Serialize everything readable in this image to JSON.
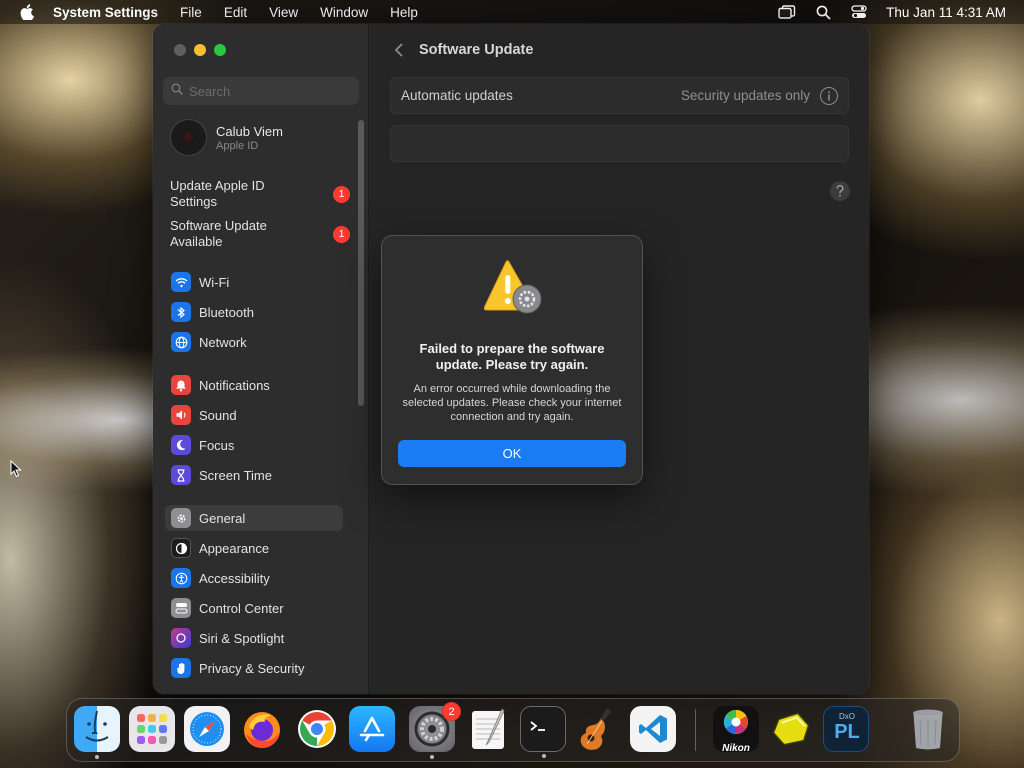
{
  "menubar": {
    "app_name": "System Settings",
    "menus": [
      "File",
      "Edit",
      "View",
      "Window",
      "Help"
    ],
    "clock": "Thu Jan 11  4:31 AM",
    "status_icons": [
      "stage-manager-icon",
      "spotlight-search-icon",
      "control-center-icon"
    ]
  },
  "window": {
    "sidebar": {
      "search_placeholder": "Search",
      "user": {
        "name": "Calub Viem",
        "subtitle": "Apple ID"
      },
      "notices": [
        {
          "label": "Update Apple ID Settings",
          "badge": "1"
        },
        {
          "label": "Software Update Available",
          "badge": "1"
        }
      ],
      "items": [
        {
          "label": "Wi-Fi",
          "icon": "wifi-icon",
          "color": "#1b74e8"
        },
        {
          "label": "Bluetooth",
          "icon": "bluetooth-icon",
          "color": "#1b74e8"
        },
        {
          "label": "Network",
          "icon": "globe-icon",
          "color": "#1b74e8"
        },
        {
          "label": "Notifications",
          "icon": "bell-icon",
          "color": "#e8453c"
        },
        {
          "label": "Sound",
          "icon": "speaker-icon",
          "color": "#e8453c"
        },
        {
          "label": "Focus",
          "icon": "moon-icon",
          "color": "#5b4bd6"
        },
        {
          "label": "Screen Time",
          "icon": "hourglass-icon",
          "color": "#5b4bd6"
        },
        {
          "label": "General",
          "icon": "gear-icon",
          "color": "#8e8e93",
          "selected": true
        },
        {
          "label": "Appearance",
          "icon": "appearance-icon",
          "color": "#1c1c1e"
        },
        {
          "label": "Accessibility",
          "icon": "accessibility-icon",
          "color": "#1b74e8"
        },
        {
          "label": "Control Center",
          "icon": "toggles-icon",
          "color": "#8e8e93"
        },
        {
          "label": "Siri & Spotlight",
          "icon": "siri-icon",
          "color": "#c03a8a"
        },
        {
          "label": "Privacy & Security",
          "icon": "hand-icon",
          "color": "#1b74e8"
        }
      ]
    },
    "main": {
      "title": "Software Update",
      "automatic_updates": {
        "label": "Automatic updates",
        "value": "Security updates only"
      }
    }
  },
  "alert": {
    "title": "Failed to prepare the software update. Please try again.",
    "message": "An error occurred while downloading the selected updates. Please check your internet connection and try again.",
    "ok_label": "OK",
    "accent": "#1a7cf4"
  },
  "dock": {
    "items": [
      {
        "app": "Finder",
        "icon": "finder-icon",
        "running": true
      },
      {
        "app": "Launchpad",
        "icon": "launchpad-icon",
        "running": false
      },
      {
        "app": "Safari",
        "icon": "safari-icon",
        "running": false
      },
      {
        "app": "Firefox",
        "icon": "firefox-icon",
        "running": false
      },
      {
        "app": "Google Chrome",
        "icon": "chrome-icon",
        "running": false
      },
      {
        "app": "App Store",
        "icon": "app-store-icon",
        "running": false
      },
      {
        "app": "System Settings",
        "icon": "system-settings-icon",
        "running": true,
        "badge": "2"
      },
      {
        "app": "TextEdit",
        "icon": "textedit-icon",
        "running": false
      },
      {
        "app": "Terminal",
        "icon": "terminal-icon",
        "running": true
      },
      {
        "app": "GarageBand",
        "icon": "garageband-icon",
        "running": false
      },
      {
        "app": "Visual Studio Code",
        "icon": "vscode-icon",
        "running": false
      },
      {
        "app": "Nikon",
        "icon": "nikon-icon",
        "running": false,
        "label": "Nikon"
      },
      {
        "app": "Sticky",
        "icon": "yellow-hexagon-icon",
        "running": false
      },
      {
        "app": "DxO PhotoLab",
        "icon": "dxo-photolab-icon",
        "running": false,
        "label": "PL",
        "sublabel": "DxO"
      },
      {
        "app": "Trash",
        "icon": "trash-icon",
        "running": false
      }
    ]
  }
}
